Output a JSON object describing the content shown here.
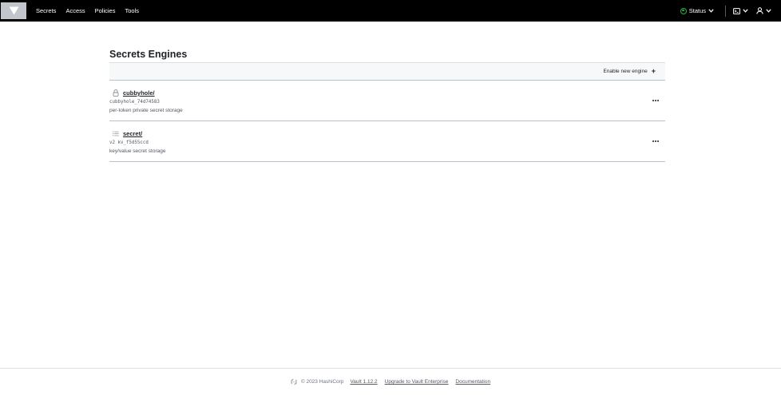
{
  "nav": {
    "logo_icon": "vault-logo-icon",
    "links": [
      "Secrets",
      "Access",
      "Policies",
      "Tools"
    ],
    "status_label": "Status",
    "status_color": "#2eb039",
    "console_icon": "terminal-icon",
    "user_icon": "user-icon"
  },
  "main": {
    "title": "Secrets Engines",
    "enable_label": "Enable new engine",
    "enable_icon": "+",
    "engines": [
      {
        "icon": "lock-icon",
        "path": "cubbyhole/",
        "accessor": "cubbyhole_74d74583",
        "description": "per-token private secret storage"
      },
      {
        "icon": "list-icon",
        "path": "secret/",
        "accessor": "v2 kv_f5d55ccd",
        "description": "key/value secret storage"
      }
    ]
  },
  "footer": {
    "copyright": "© 2023 HashiCorp",
    "version_link": "Vault 1.12.2",
    "upgrade_link": "Upgrade to Vault Enterprise",
    "docs_link": "Documentation"
  }
}
